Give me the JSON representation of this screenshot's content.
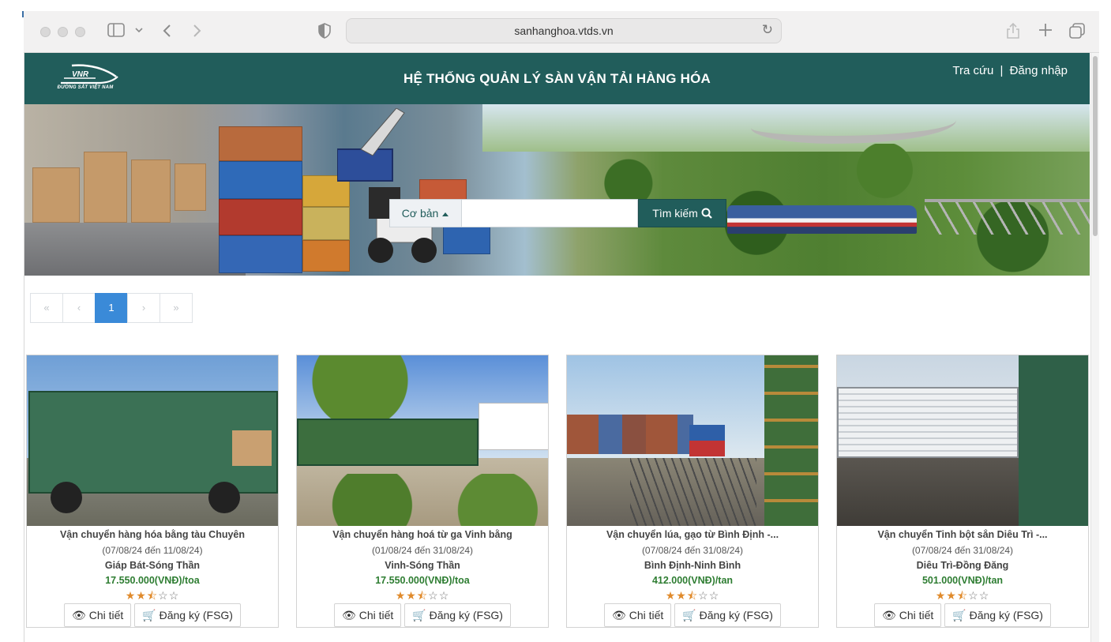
{
  "browser": {
    "address": "sanhanghoa.vtds.vn"
  },
  "header": {
    "logo_text": "VNR",
    "logo_subtext": "ĐƯỜNG SẮT VIỆT NAM",
    "title": "HỆ THỐNG QUẢN LÝ SÀN VẬN TẢI HÀNG HÓA",
    "lookup_link": "Tra cứu",
    "separator": "|",
    "login_link": "Đăng nhập"
  },
  "search": {
    "mode_label": "Cơ bản",
    "mode_icon": "caret-up-icon",
    "input_value": "",
    "button_label": "Tìm kiếm",
    "button_icon": "search-icon"
  },
  "pagination": {
    "first": "«",
    "prev": "‹",
    "current": "1",
    "next": "›",
    "last": "»"
  },
  "colors": {
    "brand": "#215d5b",
    "pagination_active": "#3a8ad8",
    "price": "#2e7d32",
    "star": "#e08a2b"
  },
  "cards": [
    {
      "title": "Vận chuyển hàng hóa bằng tàu Chuyên",
      "dates": "(07/08/24 đến 11/08/24)",
      "route": "Giáp Bát-Sóng Thần",
      "price": "17.550.000(VNĐ)/toa",
      "rating": 2.5,
      "stars": "★★⯪☆☆",
      "detail_label": "Chi tiết",
      "register_label": "Đăng ký (FSG)"
    },
    {
      "title": "Vận chuyển hàng hoá từ ga Vinh bằng",
      "dates": "(01/08/24 đến 31/08/24)",
      "route": "Vinh-Sóng Thần",
      "price": "17.550.000(VNĐ)/toa",
      "rating": 2.5,
      "stars": "★★⯪☆☆",
      "detail_label": "Chi tiết",
      "register_label": "Đăng ký (FSG)"
    },
    {
      "title": "Vận chuyển lúa, gạo từ Bình Định -...",
      "dates": "(07/08/24 đến 31/08/24)",
      "route": "Bình Định-Ninh Bình",
      "price": "412.000(VNĐ)/tan",
      "rating": 2.5,
      "stars": "★★⯪☆☆",
      "detail_label": "Chi tiết",
      "register_label": "Đăng ký (FSG)"
    },
    {
      "title": "Vận chuyển Tinh bột sắn Diêu Trì -...",
      "dates": "(07/08/24 đến 31/08/24)",
      "route": "Diêu Trì-Đồng Đăng",
      "price": "501.000(VNĐ)/tan",
      "rating": 2.5,
      "stars": "★★⯪☆☆",
      "detail_label": "Chi tiết",
      "register_label": "Đăng ký (FSG)"
    }
  ]
}
